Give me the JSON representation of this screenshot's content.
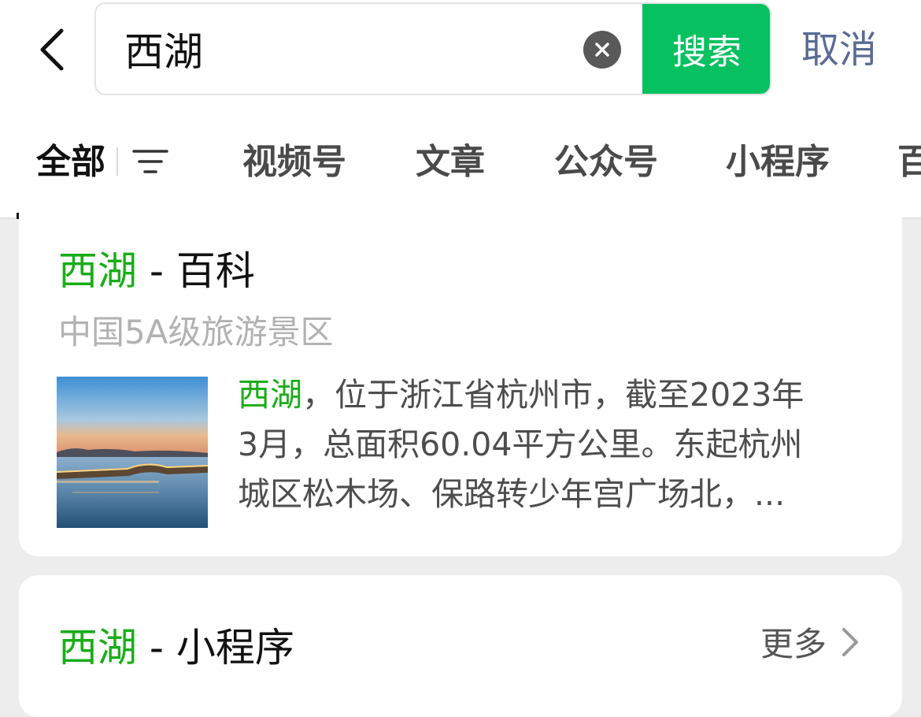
{
  "search": {
    "query": "西湖",
    "search_label": "搜索",
    "cancel_label": "取消"
  },
  "tabs": [
    {
      "label": "全部",
      "active": true
    },
    {
      "label": "视频号"
    },
    {
      "label": "文章"
    },
    {
      "label": "公众号"
    },
    {
      "label": "小程序"
    },
    {
      "label": "百"
    }
  ],
  "baike": {
    "keyword": "西湖",
    "title_suffix": " - 百科",
    "subtitle": "中国5A级旅游景区",
    "desc_keyword": "西湖",
    "desc_line1_rest": "，位于浙江省杭州市，截至2023年",
    "desc_line2": "3月，总面积60.04平方公里。东起杭州",
    "desc_line3": "城区松木场、保路转少年宫广场北，..."
  },
  "miniprogram": {
    "keyword": "西湖",
    "title_suffix": " - 小程序",
    "more_label": "更多"
  },
  "colors": {
    "accent_green": "#07c160",
    "highlight_green": "#1aad19",
    "cancel_blue": "#576b95"
  },
  "icons": [
    "back-arrow-icon",
    "clear-icon",
    "filter-icon",
    "chevron-right-icon"
  ]
}
